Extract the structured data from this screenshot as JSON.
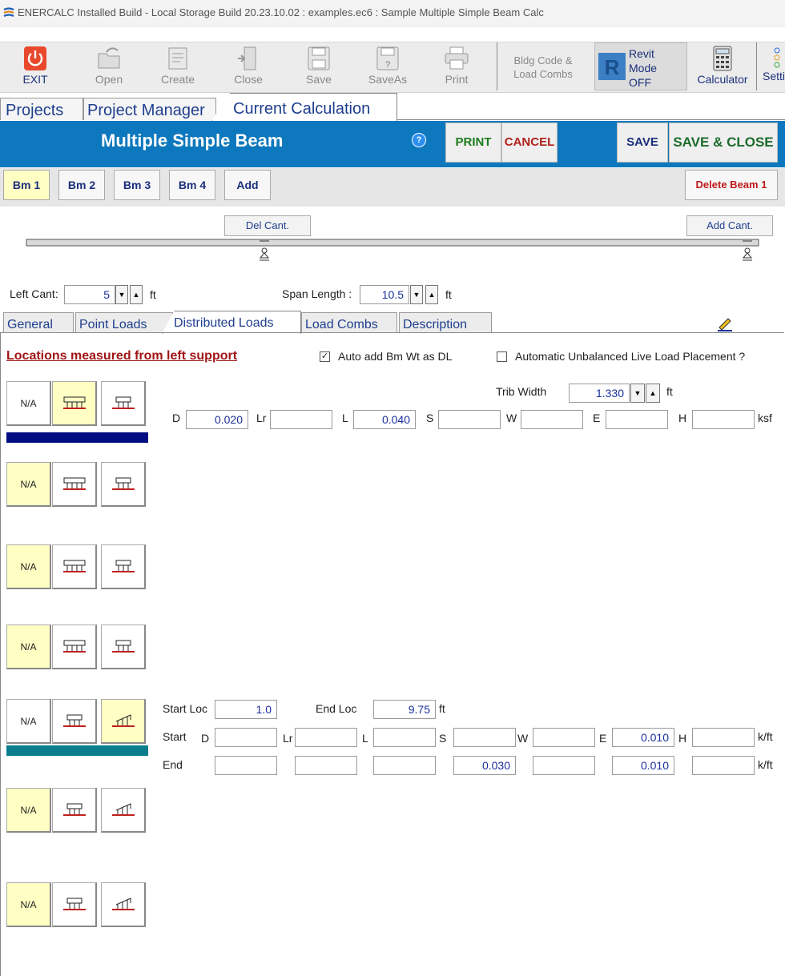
{
  "window": {
    "title": "ENERCALC Installed Build - Local Storage Build 20.23.10.02 :   examples.ec6 : Sample Multiple Simple Beam Calc"
  },
  "toolbar": {
    "exit": "EXIT",
    "open": "Open",
    "create": "Create",
    "close": "Close",
    "save": "Save",
    "saveas": "SaveAs",
    "print": "Print",
    "bldg_code": "Bldg Code &\nLoad Combs",
    "revit": "Revit\nMode\nOFF",
    "calculator": "Calculator",
    "settings": "Setti"
  },
  "top_tabs": [
    "Projects",
    "Project Manager",
    "Current Calculation"
  ],
  "header": {
    "title": "Multiple Simple Beam",
    "help": "?",
    "print": "PRINT",
    "cancel": "CANCEL",
    "save": "SAVE",
    "save_close": "SAVE & CLOSE"
  },
  "beams": {
    "tabs": [
      "Bm 1",
      "Bm 2",
      "Bm 3",
      "Bm 4",
      "Add"
    ],
    "delete": "Delete Beam 1"
  },
  "cantilever": {
    "del": "Del Cant.",
    "add": "Add Cant."
  },
  "dims": {
    "left_cant_label": "Left Cant:",
    "left_cant_value": "5",
    "left_cant_unit": "ft",
    "span_label": "Span Length :",
    "span_value": "10.5",
    "span_unit": "ft"
  },
  "sub_tabs": [
    "General",
    "Point Loads",
    "Distributed Loads",
    "Load Combs",
    "Description"
  ],
  "panel": {
    "locations_note": "Locations measured from left support",
    "auto_bm_wt": "Auto add Bm Wt as DL",
    "auto_bm_wt_checked": "✓",
    "unbalanced": "Automatic Unbalanced Live Load Placement ?",
    "trib_label": "Trib Width",
    "trib_value": "1.330",
    "trib_unit": "ft",
    "na": "N/A",
    "uniform": {
      "labels": [
        "D",
        "Lr",
        "L",
        "S",
        "W",
        "E",
        "H"
      ],
      "values": [
        "0.020",
        "",
        "0.040",
        "",
        "",
        "",
        ""
      ],
      "unit": "ksf"
    },
    "trap": {
      "start_loc_label": "Start Loc",
      "start_loc": "1.0",
      "end_loc_label": "End Loc",
      "end_loc": "9.75",
      "loc_unit": "ft",
      "start_label": "Start",
      "end_label": "End",
      "labels": [
        "D",
        "Lr",
        "L",
        "S",
        "W",
        "E",
        "H"
      ],
      "start_values": [
        "",
        "",
        "",
        "",
        "",
        "0.010",
        ""
      ],
      "end_values": [
        "",
        "",
        "",
        "0.030",
        "",
        "0.010",
        ""
      ],
      "unit": "k/ft"
    }
  },
  "colors": {
    "header_blue": "#0d78bd",
    "active_yellow": "#ffffc4",
    "bar_navy": "#000d80",
    "bar_teal": "#0a7e8c"
  }
}
